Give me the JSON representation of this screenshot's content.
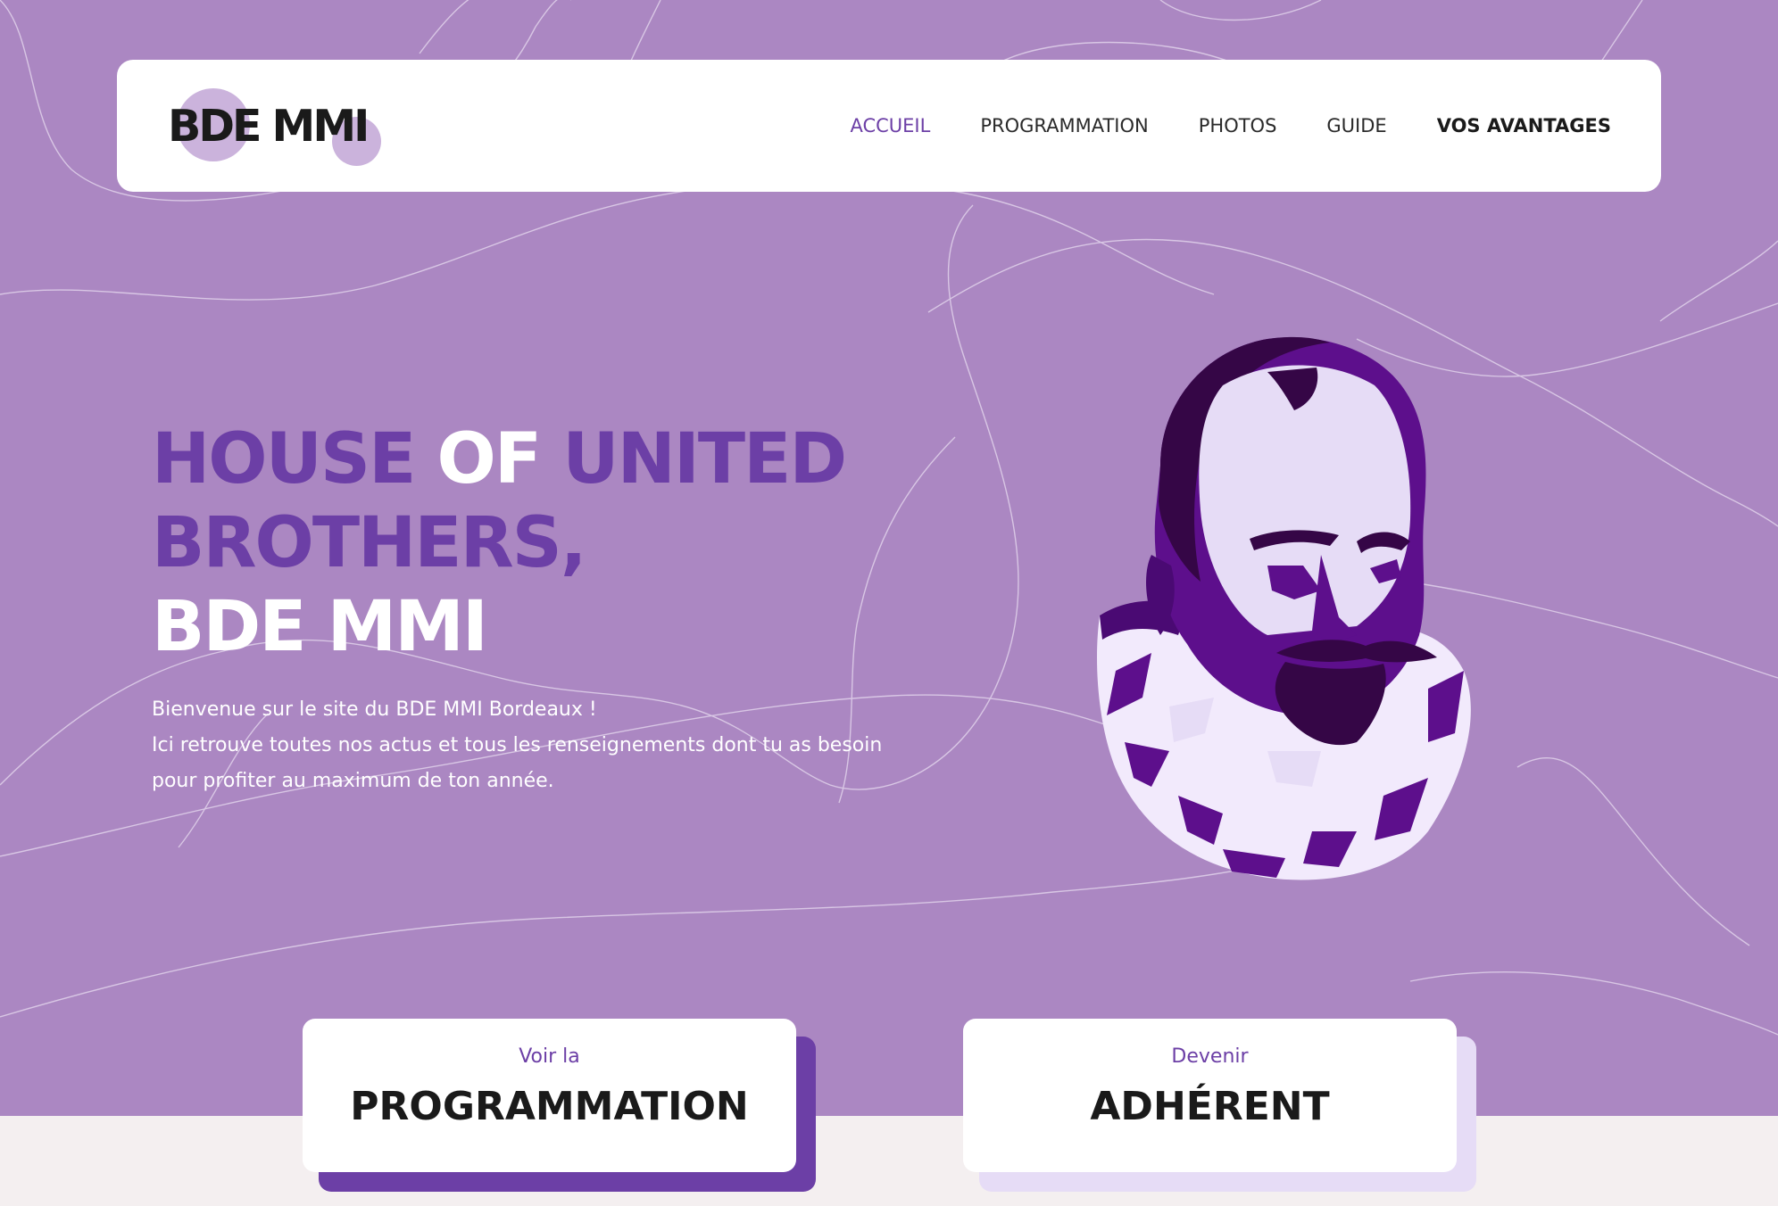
{
  "colors": {
    "background": "#ab87c2",
    "accent_purple": "#6c3fa6",
    "light_purple": "#e6dcf6",
    "bottom_band": "#f4eff0"
  },
  "header": {
    "logo_text": "BDE MMI",
    "nav": [
      "ACCUEIL",
      "PROGRAMMATION",
      "PHOTOS",
      "GUIDE",
      "VOS AVANTAGES"
    ],
    "active_nav": "ACCUEIL"
  },
  "hero": {
    "title_part1": "HOUSE ",
    "title_part2": "OF ",
    "title_part3": "UNITED",
    "title_line2": "BROTHERS,",
    "title_line3": "BDE MMI",
    "text_line1": "Bienvenue sur le site du BDE MMI Bordeaux !",
    "text_line2": "Ici retrouve toutes nos actus et tous les renseignements dont tu as besoin pour profiter au maximum de ton année.",
    "illustration": "montaigne-portrait-illustration"
  },
  "cta": [
    {
      "small": "Voir la",
      "big": "PROGRAMMATION"
    },
    {
      "small": "Devenir",
      "big": "ADHÉRENT"
    }
  ]
}
